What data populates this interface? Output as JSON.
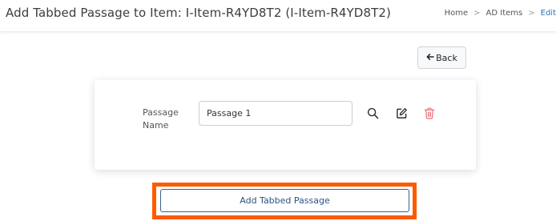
{
  "header": {
    "title": "Add Tabbed Passage to Item: I-Item-R4YD8T2 (I-Item-R4YD8T2)",
    "breadcrumb": [
      {
        "label": "Home"
      },
      {
        "label": "AD Items"
      },
      {
        "label": "Edit"
      }
    ],
    "breadcrumb_separator": ">"
  },
  "toolbar": {
    "back_label": "Back",
    "back_icon": "arrow-left-icon"
  },
  "passage": {
    "label": "Passage Name",
    "value": "Passage 1",
    "actions": [
      {
        "icon": "search-icon"
      },
      {
        "icon": "edit-icon"
      },
      {
        "icon": "trash-icon",
        "color": "#e8727a"
      }
    ]
  },
  "footer": {
    "add_label": "Add Tabbed Passage"
  },
  "colors": {
    "highlight": "#ff5a00",
    "link": "#2f6fb5",
    "delete": "#e8727a"
  }
}
